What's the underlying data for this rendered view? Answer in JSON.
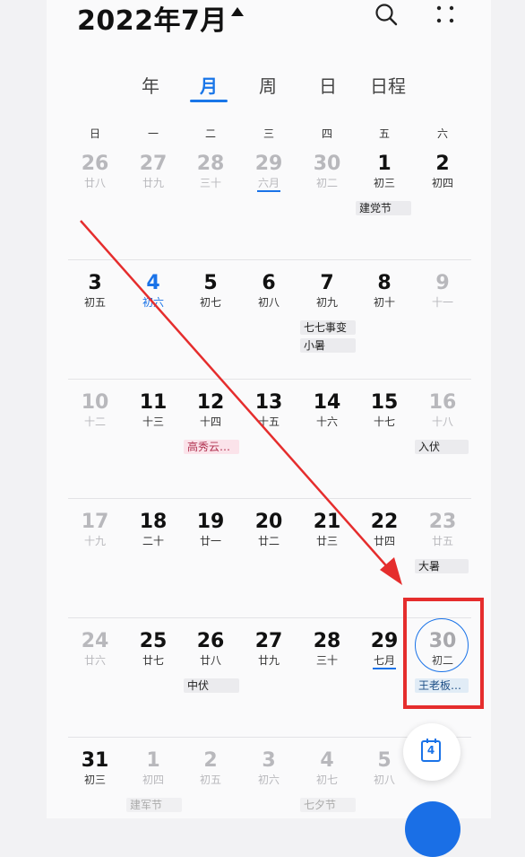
{
  "header": {
    "title": "2022年7月"
  },
  "tabs": [
    {
      "label": "年"
    },
    {
      "label": "月"
    },
    {
      "label": "周"
    },
    {
      "label": "日"
    },
    {
      "label": "日程"
    }
  ],
  "weekdays": [
    "日",
    "一",
    "二",
    "三",
    "四",
    "五",
    "六"
  ],
  "weeks": [
    {
      "days": [
        {
          "d": "26",
          "l": "廿八",
          "dim": true
        },
        {
          "d": "27",
          "l": "廿九",
          "dim": true
        },
        {
          "d": "28",
          "l": "三十",
          "dim": true
        },
        {
          "d": "29",
          "l": "六月",
          "dim": true,
          "underline": true
        },
        {
          "d": "30",
          "l": "初二",
          "dim": true
        },
        {
          "d": "1",
          "l": "初三"
        },
        {
          "d": "2",
          "l": "初四"
        }
      ],
      "tags": [
        {
          "col": 5,
          "text": "建党节",
          "style": ""
        }
      ]
    },
    {
      "days": [
        {
          "d": "3",
          "l": "初五"
        },
        {
          "d": "4",
          "l": "初六",
          "blue": true
        },
        {
          "d": "5",
          "l": "初七"
        },
        {
          "d": "6",
          "l": "初八"
        },
        {
          "d": "7",
          "l": "初九"
        },
        {
          "d": "8",
          "l": "初十"
        },
        {
          "d": "9",
          "l": "十一",
          "dim": true
        }
      ],
      "tags": [
        {
          "col": 4,
          "text": "七七事变",
          "style": ""
        },
        {
          "col": 4,
          "text": "小暑",
          "style": "",
          "line": 2
        }
      ]
    },
    {
      "days": [
        {
          "d": "10",
          "l": "十二",
          "dim": true
        },
        {
          "d": "11",
          "l": "十三"
        },
        {
          "d": "12",
          "l": "十四"
        },
        {
          "d": "13",
          "l": "十五"
        },
        {
          "d": "14",
          "l": "十六"
        },
        {
          "d": "15",
          "l": "十七"
        },
        {
          "d": "16",
          "l": "十八",
          "dim": true
        }
      ],
      "tags": [
        {
          "col": 2,
          "text": "高秀云…",
          "style": "pink"
        },
        {
          "col": 6,
          "text": "入伏",
          "style": ""
        }
      ]
    },
    {
      "days": [
        {
          "d": "17",
          "l": "十九",
          "dim": true
        },
        {
          "d": "18",
          "l": "二十"
        },
        {
          "d": "19",
          "l": "廿一"
        },
        {
          "d": "20",
          "l": "廿二"
        },
        {
          "d": "21",
          "l": "廿三"
        },
        {
          "d": "22",
          "l": "廿四"
        },
        {
          "d": "23",
          "l": "廿五",
          "dim": true
        }
      ],
      "tags": [
        {
          "col": 6,
          "text": "大暑",
          "style": ""
        }
      ]
    },
    {
      "days": [
        {
          "d": "24",
          "l": "廿六",
          "dim": true
        },
        {
          "d": "25",
          "l": "廿七"
        },
        {
          "d": "26",
          "l": "廿八"
        },
        {
          "d": "27",
          "l": "廿九"
        },
        {
          "d": "28",
          "l": "三十"
        },
        {
          "d": "29",
          "l": "七月",
          "underline": true
        },
        {
          "d": "30",
          "l": "初二",
          "dim": true,
          "selected": true
        }
      ],
      "tags": [
        {
          "col": 2,
          "text": "中伏",
          "style": ""
        },
        {
          "col": 6,
          "text": "王老板…",
          "style": "blue"
        }
      ]
    },
    {
      "days": [
        {
          "d": "31",
          "l": "初三"
        },
        {
          "d": "1",
          "l": "初四",
          "dim": true
        },
        {
          "d": "2",
          "l": "初五",
          "dim": true
        },
        {
          "d": "3",
          "l": "初六",
          "dim": true
        },
        {
          "d": "4",
          "l": "初七",
          "dim": true
        },
        {
          "d": "5",
          "l": "初八",
          "dim": true
        },
        {
          "d": "",
          "l": "",
          "dim": true
        }
      ],
      "tags": [
        {
          "col": 1,
          "text": "建军节",
          "style": "dim"
        },
        {
          "col": 4,
          "text": "七夕节",
          "style": "dim"
        }
      ]
    }
  ],
  "fab": {
    "today_num": "4"
  },
  "colors": {
    "accent": "#1a73e8",
    "annotation": "#e52d2d",
    "fab": "#1a6fe6"
  },
  "icons": [
    "search-icon",
    "more-icon",
    "dropdown-triangle-icon",
    "calendar-today-icon"
  ]
}
